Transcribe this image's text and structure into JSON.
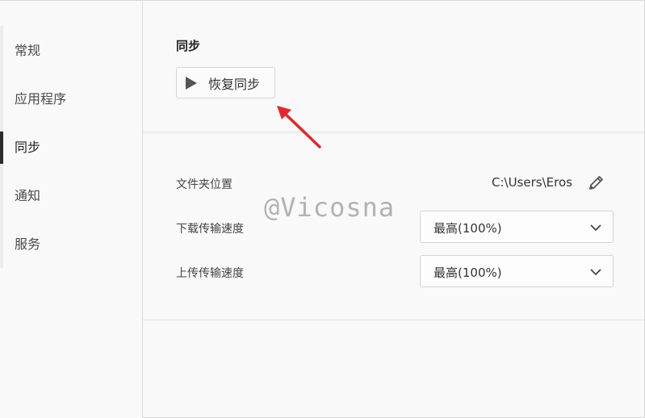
{
  "sidebar": {
    "items": [
      {
        "label": "常规"
      },
      {
        "label": "应用程序"
      },
      {
        "label": "同步"
      },
      {
        "label": "通知"
      },
      {
        "label": "服务"
      }
    ],
    "active_index": 2
  },
  "main": {
    "section_title": "同步",
    "resume_button": {
      "label": "恢复同步",
      "icon": "play-icon"
    },
    "folder_location": {
      "label": "文件夹位置",
      "value": "C:\\Users\\Eros",
      "icon": "pencil-icon"
    },
    "download_speed": {
      "label": "下载传输速度",
      "value": "最高(100%)",
      "icon": "chevron-down-icon"
    },
    "upload_speed": {
      "label": "上传传输速度",
      "value": "最高(100%)",
      "icon": "chevron-down-icon"
    }
  },
  "watermark": "@Vicosna",
  "colors": {
    "background": "#f9f9f9",
    "active_indicator": "#2b2b2b",
    "annotation_arrow": "#e0282e"
  }
}
